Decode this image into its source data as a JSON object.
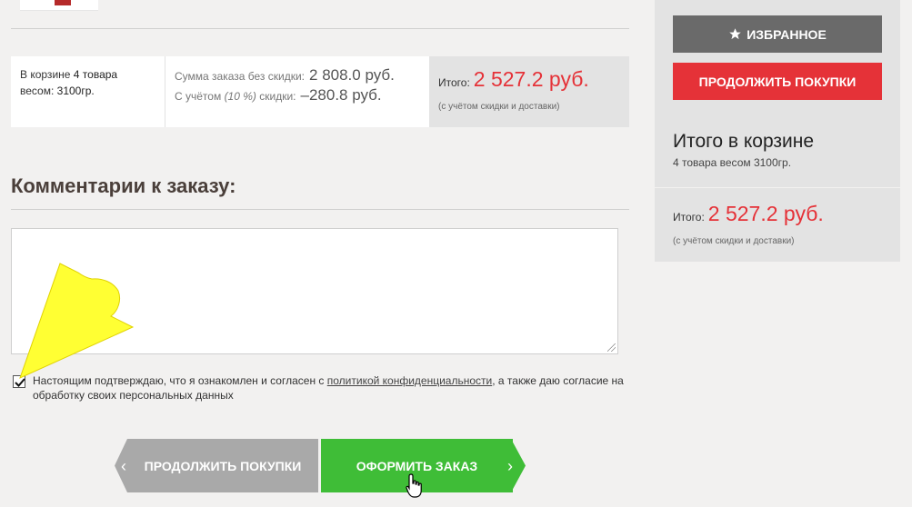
{
  "summary": {
    "in_cart_prefix": "В корзине",
    "items_count": "4 товара",
    "weight_prefix": "весом:",
    "weight_value": "3100гр.",
    "sum_no_discount_label": "Сумма заказа без скидки:",
    "sum_no_discount_value": "2 808.0 руб.",
    "discount_label_prefix": "С учётом",
    "discount_percent": "(10 %)",
    "discount_label_suffix": "скидки:",
    "discount_value": "–280.8 руб.",
    "total_label": "Итого:",
    "total_value": "2 527.2 руб.",
    "total_note": "(с учётом скидки и доставки)"
  },
  "comments": {
    "title": "Комментарии к заказу:",
    "value": ""
  },
  "consent": {
    "checked": true,
    "text_before": "Настоящим подтверждаю, что я ознакомлен и согласен с ",
    "link_text": "политикой конфиденциальности",
    "text_after": ", а также даю согласие на обработку своих персональных данных"
  },
  "buttons": {
    "continue_label": "ПРОДОЛЖИТЬ ПОКУПКИ",
    "order_label": "ОФОРМИТЬ ЗАКАЗ"
  },
  "sidebar": {
    "favorites_label": "ИЗБРАННОЕ",
    "continue_label": "ПРОДОЛЖИТЬ ПОКУПКИ",
    "total_title": "Итого в корзине",
    "total_sub": "4 товара весом 3100гр.",
    "total_label": "Итого:",
    "total_value": "2 527.2 руб.",
    "total_note": "(с учётом скидки и доставки)"
  },
  "icons": {
    "favorites": "star-icon",
    "prev": "chevron-left-icon",
    "next": "chevron-right-icon",
    "cursor": "hand-pointer-icon",
    "annotation": "yellow-arrow-icon"
  },
  "colors": {
    "accent_red": "#e53238",
    "order_green": "#3fbd37",
    "continue_gray": "#a9a9a9",
    "favorites_gray": "#6a6a6a",
    "annotation_yellow": "#ffff33"
  }
}
